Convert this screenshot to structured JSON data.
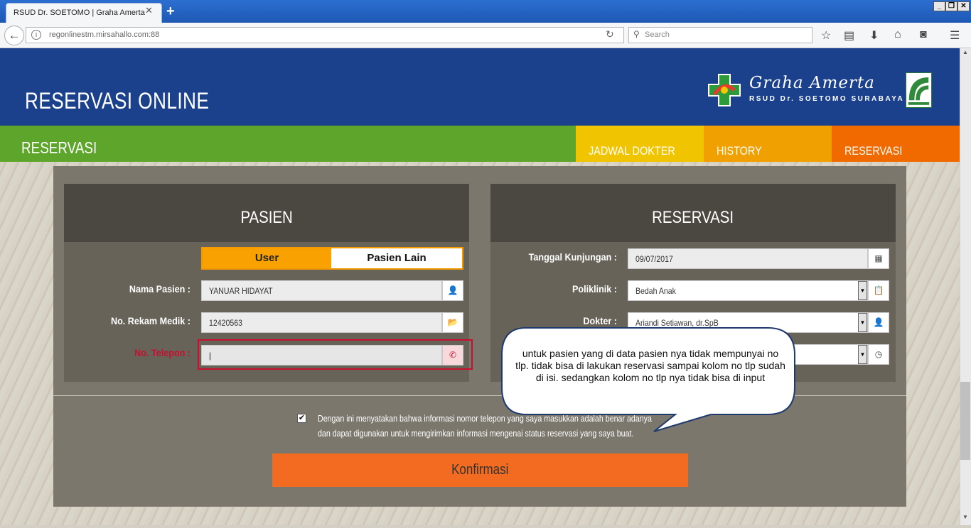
{
  "browser": {
    "tab_title": "RSUD Dr. SOETOMO | Graha Amerta",
    "tab_close": "✕",
    "new_tab": "+",
    "url": "regonlinestm.mirsahallo.com:88",
    "search_placeholder": "Search",
    "window_buttons": [
      "_",
      "❐",
      "✕"
    ]
  },
  "header": {
    "title": "RESERVASI ONLINE",
    "logo_name": "Graha Amerta",
    "logo_subtitle": "RSUD Dr. SOETOMO SURABAYA"
  },
  "nav": {
    "page_title": "RESERVASI",
    "tabs": [
      {
        "label": "JADWAL DOKTER",
        "color": "#f1c400"
      },
      {
        "label": "HISTORY",
        "color": "#f0a000"
      },
      {
        "label": "RESERVASI",
        "color": "#f06a00"
      }
    ]
  },
  "pasien": {
    "heading": "PASIEN",
    "toggle_user": "User",
    "toggle_lain": "Pasien Lain",
    "nama_label": "Nama Pasien :",
    "nama_value": "YANUAR HIDAYAT",
    "rekam_label": "No. Rekam Medik :",
    "rekam_value": "12420563",
    "telepon_label": "No. Telepon :",
    "telepon_value": "|"
  },
  "reservasi": {
    "heading": "RESERVASI",
    "tanggal_label": "Tanggal Kunjungan :",
    "tanggal_value": "09/07/2017",
    "poli_label": "Poliklinik :",
    "poli_value": "Bedah Anak",
    "dokter_label": "Dokter :",
    "dokter_value": "Ariandi Setiawan, dr.SpB"
  },
  "consent": {
    "line1": "Dengan ini menyatakan bahwa informasi nomor telepon yang saya masukkan adalah benar adanya",
    "line2": "dan dapat digunakan untuk mengirimkan informasi mengenai status reservasi yang saya buat."
  },
  "confirm_label": "Konfirmasi",
  "callout": "untuk pasien  yang di data pasien nya tidak mempunyai no tlp. tidak bisa di lakukan reservasi sampai kolom no tlp sudah di isi. sedangkan kolom no tlp nya tidak bisa di input",
  "colors": {
    "header": "#1b418c",
    "nav": "#5da52b",
    "accent": "#f26b21",
    "error": "#c8102e"
  }
}
